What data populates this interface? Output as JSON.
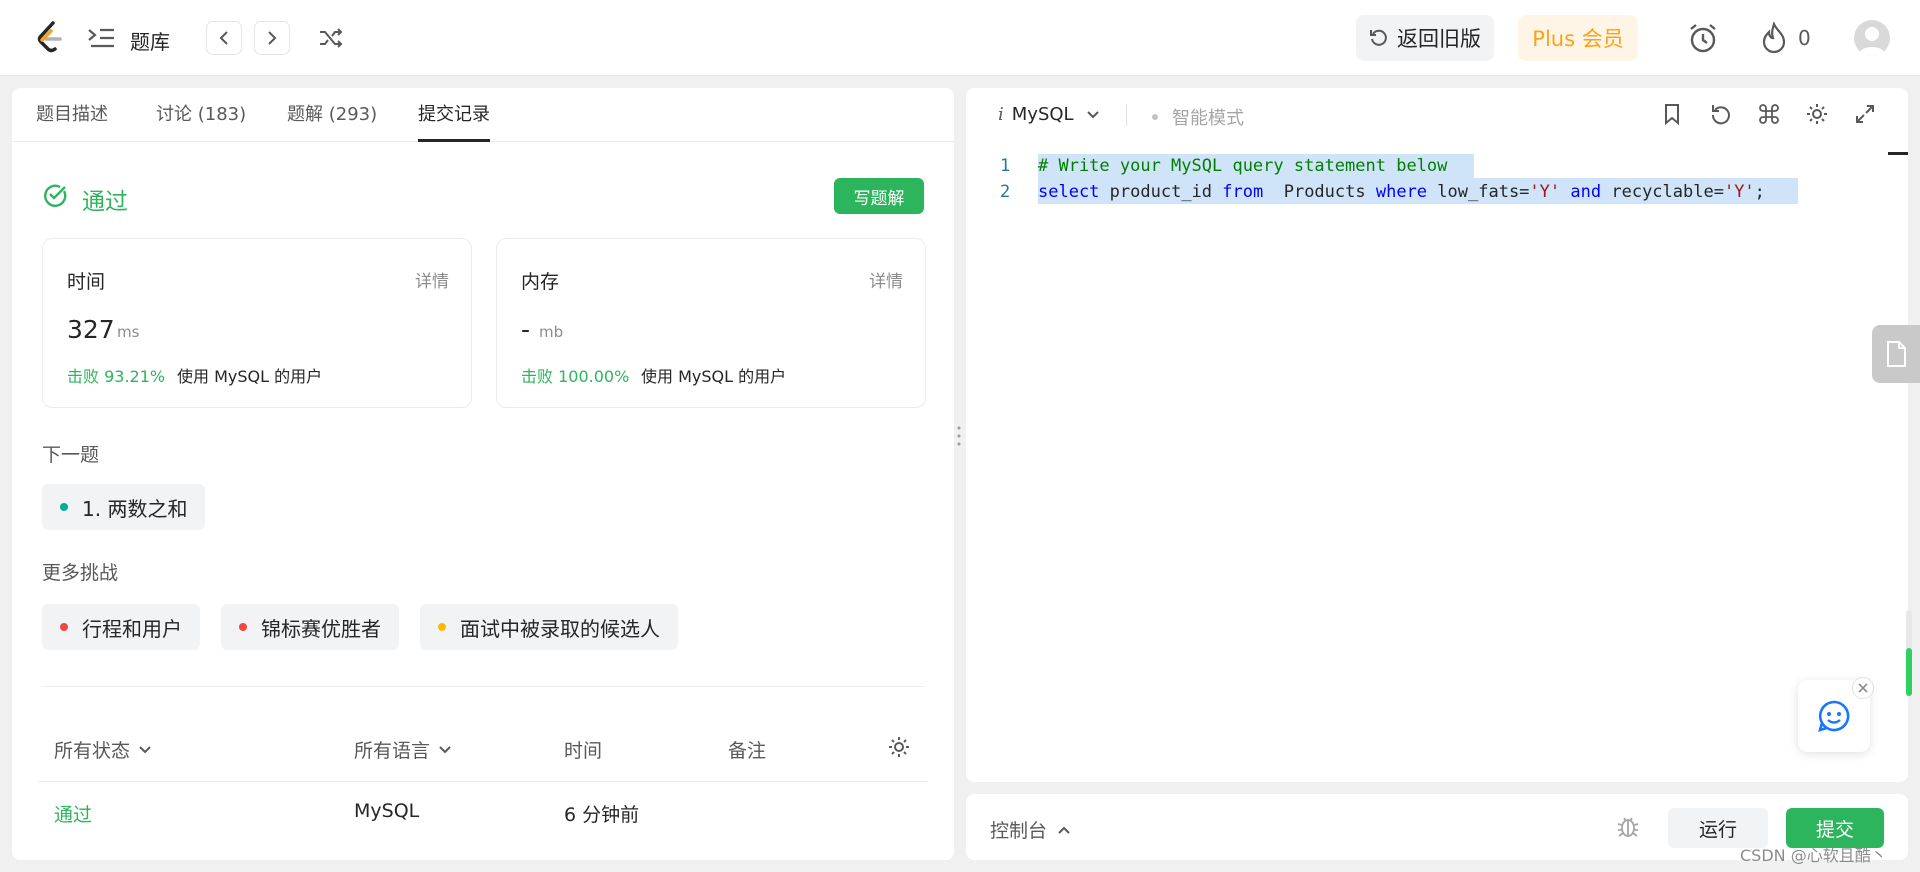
{
  "header": {
    "problem_list_label": "题库",
    "back_to_old_label": "返回旧版",
    "plus_label": "Plus 会员",
    "streak_count": "0"
  },
  "left": {
    "tabs": [
      {
        "label": "题目描述"
      },
      {
        "label": "讨论 (183)"
      },
      {
        "label": "题解 (293)"
      },
      {
        "label": "提交记录"
      }
    ],
    "result": {
      "status": "通过",
      "write_solution_label": "写题解"
    },
    "time_card": {
      "title": "时间",
      "detail": "详情",
      "value": "327",
      "unit": "ms",
      "beat_label": "击败 93.21%",
      "beat_suffix": "使用 MySQL 的用户"
    },
    "memory_card": {
      "title": "内存",
      "detail": "详情",
      "value": "-",
      "unit": "mb",
      "beat_label": "击败 100.00%",
      "beat_suffix": "使用 MySQL 的用户"
    },
    "next_label": "下一题",
    "next_problem": "1. 两数之和",
    "more_label": "更多挑战",
    "challenges": [
      {
        "label": "行程和用户",
        "color": "#ef4743"
      },
      {
        "label": "锦标赛优胜者",
        "color": "#ef4743"
      },
      {
        "label": "面试中被录取的候选人",
        "color": "#ffb800"
      }
    ],
    "next_dot_color": "#00af9b",
    "table": {
      "headers": [
        "所有状态",
        "所有语言",
        "时间",
        "备注"
      ],
      "row": {
        "status": "通过",
        "language": "MySQL",
        "time": "6 分钟前"
      }
    }
  },
  "editor": {
    "language": "MySQL",
    "mode": "智能模式",
    "line_numbers": [
      "1",
      "2"
    ],
    "line1": "# Write your MySQL query statement below",
    "line2_tokens": {
      "select": "select",
      "col": "product_id",
      "from": "from",
      "table": "Products",
      "where": "where",
      "cond1": "low_fats=",
      "v1": "'Y'",
      "and": "and",
      "cond2": "recyclable=",
      "v2": "'Y'",
      "end": ";"
    }
  },
  "footer": {
    "console_label": "控制台",
    "run_label": "运行",
    "submit_label": "提交",
    "watermark": "CSDN @心软且酷丶"
  },
  "colors": {
    "accent_green": "#2db55d",
    "plus_orange": "#ffa116"
  }
}
